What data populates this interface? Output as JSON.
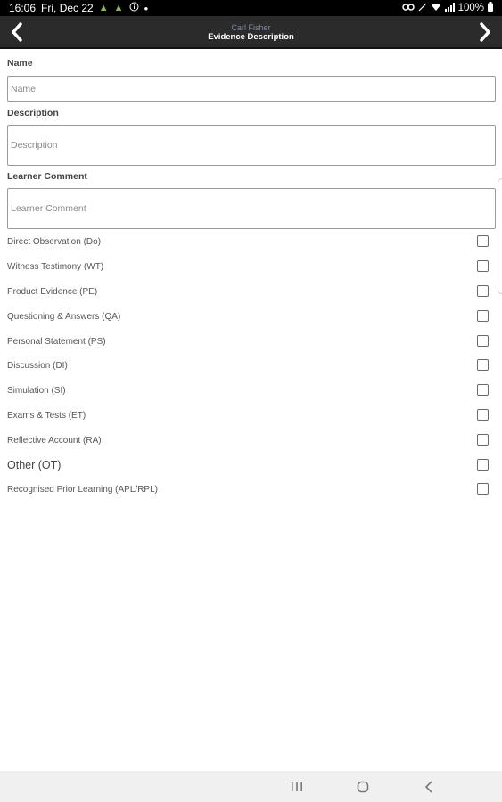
{
  "status": {
    "time": "16:06",
    "date": "Fri, Dec 22",
    "battery": "100%"
  },
  "header": {
    "subtitle": "Carl Fisher",
    "title": "Evidence Description"
  },
  "form": {
    "name_label": "Name",
    "name_placeholder": "Name",
    "description_label": "Description",
    "description_placeholder": "Description",
    "comment_label": "Learner Comment",
    "comment_placeholder": "Learner Comment"
  },
  "options": [
    {
      "label": "Direct Observation (Do)"
    },
    {
      "label": "Witness Testimony (WT)"
    },
    {
      "label": "Product Evidence (PE)"
    },
    {
      "label": "Questioning & Answers (QA)"
    },
    {
      "label": "Personal Statement (PS)"
    },
    {
      "label": "Discussion (DI)"
    },
    {
      "label": "Simulation (SI)"
    },
    {
      "label": "Exams & Tests (ET)"
    },
    {
      "label": "Reflective Account (RA)"
    },
    {
      "label": "Other (OT)"
    },
    {
      "label": "Recognised Prior Learning (APL/RPL)"
    }
  ]
}
